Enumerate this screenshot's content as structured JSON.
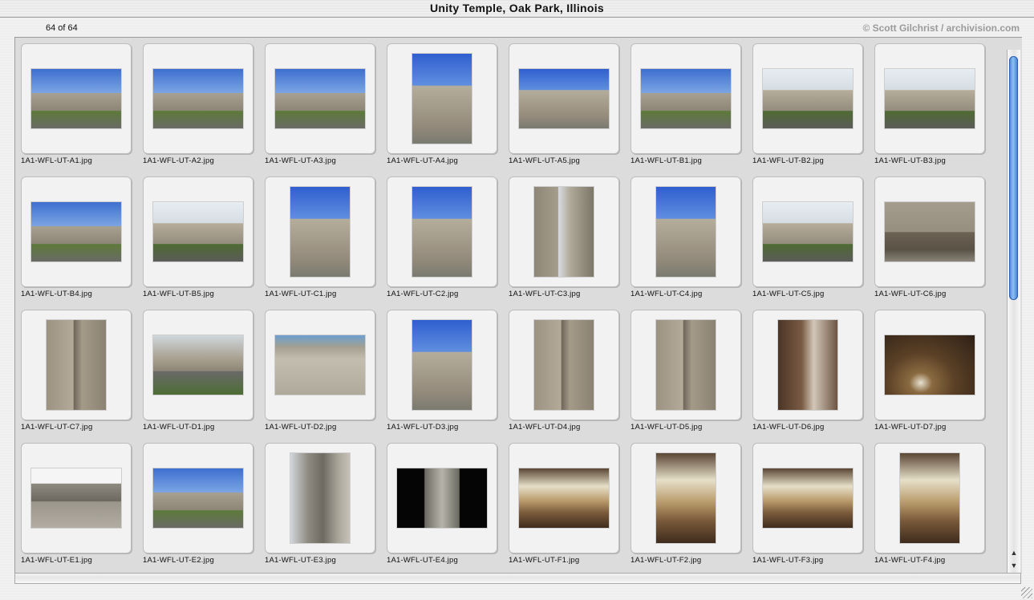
{
  "window": {
    "title": "Unity Temple, Oak Park, Illinois",
    "counter": "64 of 64",
    "credit": "© Scott Gilchrist / archivision.com"
  },
  "scrollbar": {
    "up_arrow": "▲",
    "down_arrow": "▼"
  },
  "images": [
    {
      "name": "1A1-WFL-UT-A1.jpg",
      "orientation": "landscape",
      "photo": "exterior-blue-sky-with-trees"
    },
    {
      "name": "1A1-WFL-UT-A2.jpg",
      "orientation": "landscape",
      "photo": "exterior-blue-sky-with-trees"
    },
    {
      "name": "1A1-WFL-UT-A3.jpg",
      "orientation": "landscape",
      "photo": "exterior-blue-sky-with-trees"
    },
    {
      "name": "1A1-WFL-UT-A4.jpg",
      "orientation": "portrait",
      "photo": "exterior-blue-sky"
    },
    {
      "name": "1A1-WFL-UT-A5.jpg",
      "orientation": "landscape",
      "photo": "exterior-blue-sky"
    },
    {
      "name": "1A1-WFL-UT-B1.jpg",
      "orientation": "landscape",
      "photo": "exterior-blue-sky-with-trees"
    },
    {
      "name": "1A1-WFL-UT-B2.jpg",
      "orientation": "landscape",
      "photo": "exterior-pale-sky-with-trees"
    },
    {
      "name": "1A1-WFL-UT-B3.jpg",
      "orientation": "landscape",
      "photo": "exterior-pale-sky-with-trees"
    },
    {
      "name": "1A1-WFL-UT-B4.jpg",
      "orientation": "landscape",
      "photo": "exterior-blue-sky-with-trees"
    },
    {
      "name": "1A1-WFL-UT-B5.jpg",
      "orientation": "landscape",
      "photo": "exterior-pale-sky-with-trees"
    },
    {
      "name": "1A1-WFL-UT-C1.jpg",
      "orientation": "portrait",
      "photo": "exterior-blue-sky"
    },
    {
      "name": "1A1-WFL-UT-C2.jpg",
      "orientation": "portrait",
      "photo": "exterior-blue-sky"
    },
    {
      "name": "1A1-WFL-UT-C3.jpg",
      "orientation": "portrait",
      "photo": "exterior-walkway"
    },
    {
      "name": "1A1-WFL-UT-C4.jpg",
      "orientation": "portrait",
      "photo": "exterior-blue-sky"
    },
    {
      "name": "1A1-WFL-UT-C5.jpg",
      "orientation": "landscape",
      "photo": "exterior-pale-sky-with-trees"
    },
    {
      "name": "1A1-WFL-UT-C6.jpg",
      "orientation": "landscape",
      "photo": "entrance-facade"
    },
    {
      "name": "1A1-WFL-UT-C7.jpg",
      "orientation": "portrait",
      "photo": "concrete-wall"
    },
    {
      "name": "1A1-WFL-UT-D1.jpg",
      "orientation": "landscape",
      "photo": "exterior-street-view"
    },
    {
      "name": "1A1-WFL-UT-D2.jpg",
      "orientation": "landscape",
      "photo": "concrete-wall-with-columns"
    },
    {
      "name": "1A1-WFL-UT-D3.jpg",
      "orientation": "portrait",
      "photo": "exterior-blue-sky"
    },
    {
      "name": "1A1-WFL-UT-D4.jpg",
      "orientation": "portrait",
      "photo": "concrete-wall"
    },
    {
      "name": "1A1-WFL-UT-D5.jpg",
      "orientation": "portrait",
      "photo": "concrete-wall"
    },
    {
      "name": "1A1-WFL-UT-D6.jpg",
      "orientation": "portrait",
      "photo": "interior-stairwell"
    },
    {
      "name": "1A1-WFL-UT-D7.jpg",
      "orientation": "landscape",
      "photo": "interior-dark"
    },
    {
      "name": "1A1-WFL-UT-E1.jpg",
      "orientation": "landscape",
      "photo": "column-detail-white-sky"
    },
    {
      "name": "1A1-WFL-UT-E2.jpg",
      "orientation": "landscape",
      "photo": "exterior-blue-sky-with-trees"
    },
    {
      "name": "1A1-WFL-UT-E3.jpg",
      "orientation": "portrait",
      "photo": "column-detail"
    },
    {
      "name": "1A1-WFL-UT-E4.jpg",
      "orientation": "landscape",
      "photo": "window-black"
    },
    {
      "name": "1A1-WFL-UT-F1.jpg",
      "orientation": "landscape",
      "photo": "interior-sanctuary"
    },
    {
      "name": "1A1-WFL-UT-F2.jpg",
      "orientation": "portrait",
      "photo": "interior-sanctuary"
    },
    {
      "name": "1A1-WFL-UT-F3.jpg",
      "orientation": "landscape",
      "photo": "interior-sanctuary"
    },
    {
      "name": "1A1-WFL-UT-F4.jpg",
      "orientation": "portrait",
      "photo": "interior-sanctuary"
    }
  ]
}
